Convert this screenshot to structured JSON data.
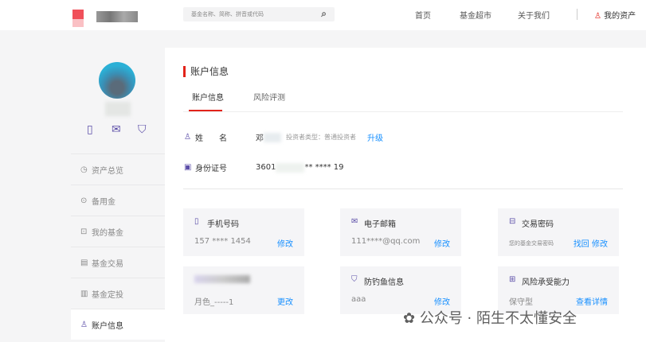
{
  "header": {
    "search_placeholder": "基金名称、简称、拼音或代码",
    "nav": [
      "首页",
      "基金超市",
      "关于我们"
    ],
    "my_assets": "我的资产"
  },
  "sidebar": {
    "items": [
      {
        "icon": "clock-icon",
        "label": "资产总览"
      },
      {
        "icon": "coin-icon",
        "label": "备用金"
      },
      {
        "icon": "chart-icon",
        "label": "我的基金"
      },
      {
        "icon": "calendar-icon",
        "label": "基金交易"
      },
      {
        "icon": "bar-icon",
        "label": "基金定投"
      },
      {
        "icon": "user-icon",
        "label": "账户信息"
      }
    ]
  },
  "main": {
    "title": "账户信息",
    "tabs": [
      "账户信息",
      "风险评测"
    ],
    "name_label": "姓　　名",
    "name_value": "邓",
    "investor_type": "投资者类型：普通投资者",
    "upgrade": "升级",
    "id_label": "身份证号",
    "id_prefix": "3601",
    "id_suffix": "** **** 19",
    "cards": [
      {
        "icon": "phone-icon",
        "title": "手机号码",
        "value": "157 **** 1454",
        "actions": [
          "修改"
        ]
      },
      {
        "icon": "mail-icon",
        "title": "电子邮箱",
        "value": "111****@qq.com",
        "actions": [
          "修改"
        ]
      },
      {
        "icon": "lock-icon",
        "title": "交易密码",
        "value": "您的基金交易密码",
        "actions": [
          "找回",
          "修改"
        ]
      },
      {
        "icon": "",
        "title": "",
        "value": "月色_-----1",
        "actions": [
          "更改"
        ]
      },
      {
        "icon": "shield-icon",
        "title": "防钓鱼信息",
        "value": "aaa",
        "actions": [
          "修改"
        ]
      },
      {
        "icon": "risk-icon",
        "title": "风险承受能力",
        "value": "保守型",
        "actions": [
          "查看详情"
        ]
      }
    ]
  },
  "watermark": "公众号 · 陌生不太懂安全"
}
